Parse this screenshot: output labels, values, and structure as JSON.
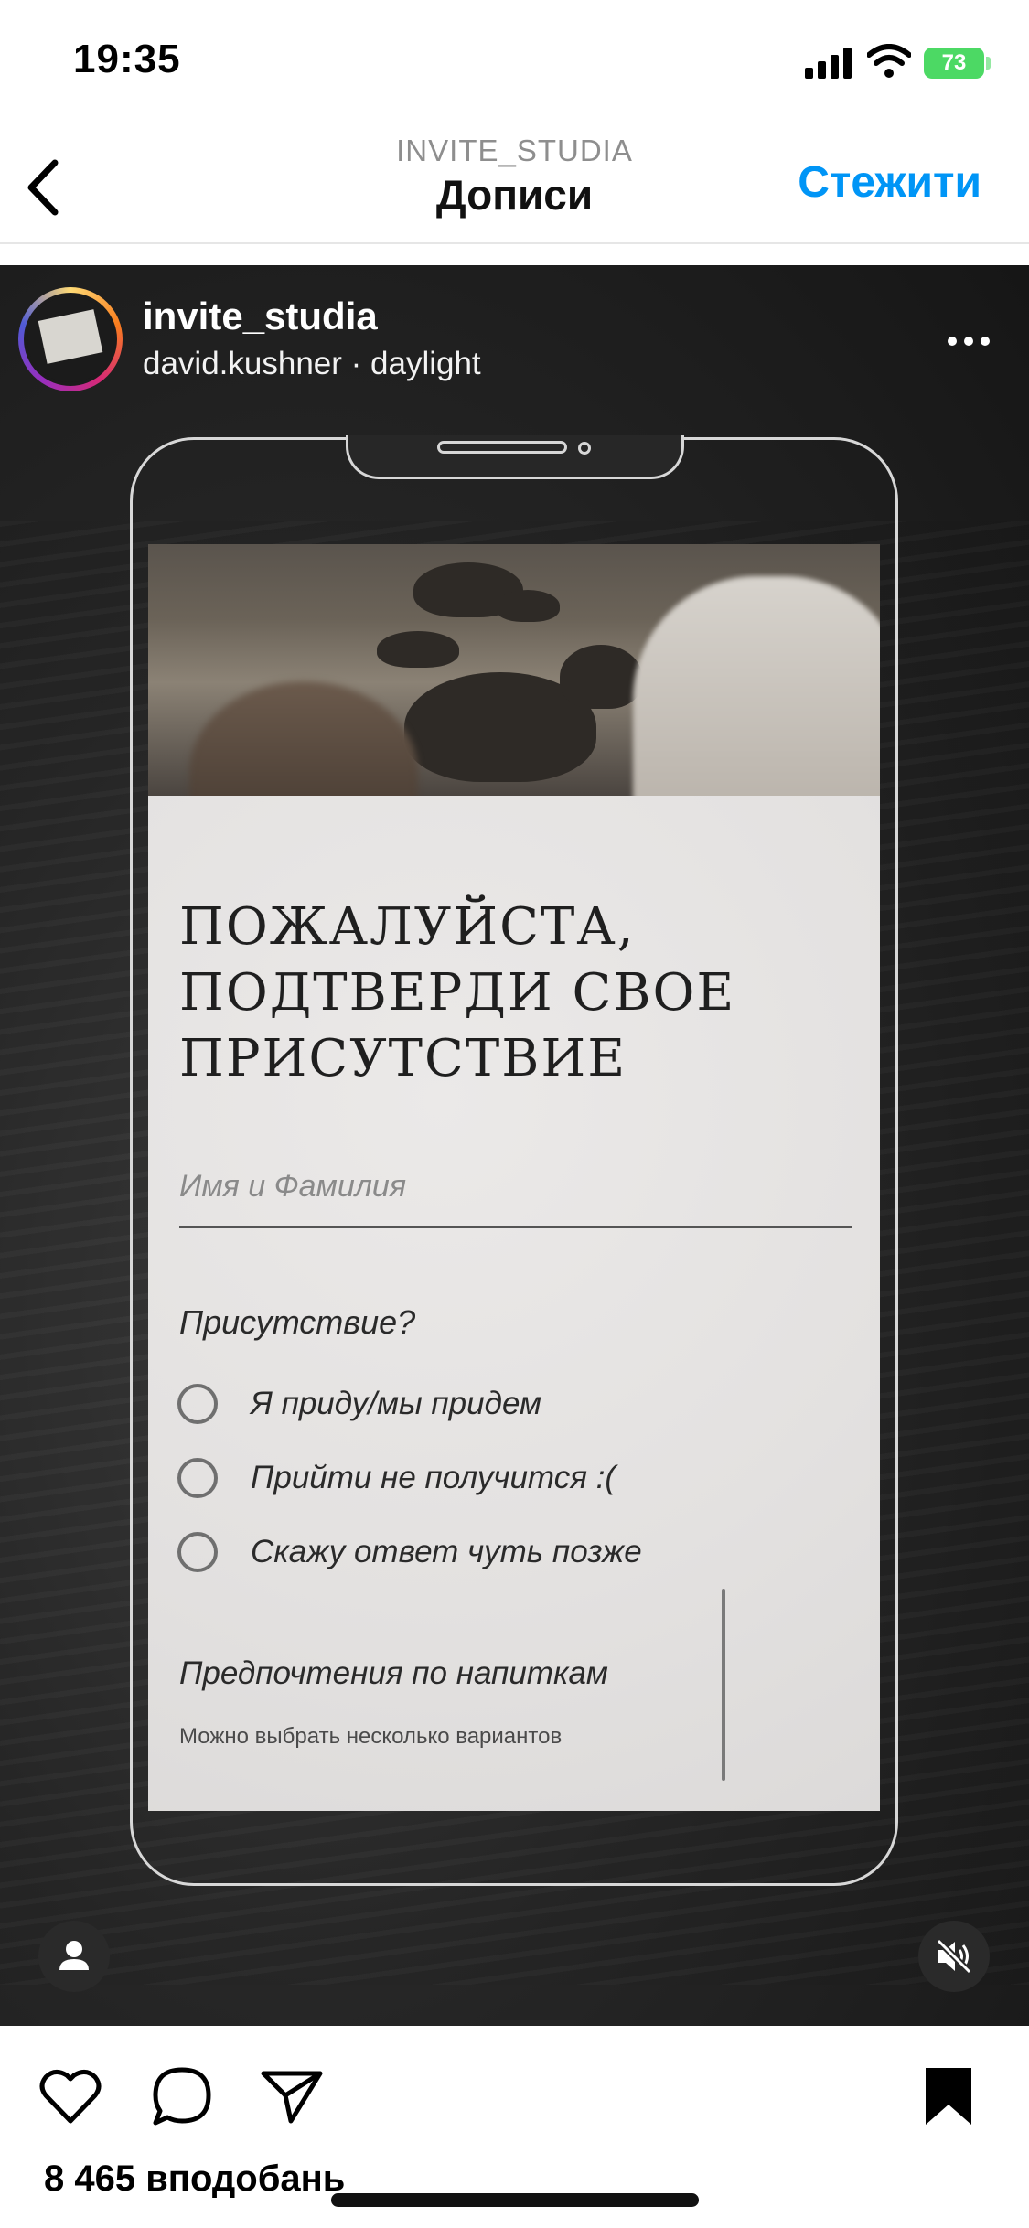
{
  "status_bar": {
    "time": "19:35",
    "battery": "73"
  },
  "header": {
    "subtitle": "INVITE_STUDIA",
    "title": "Дописи",
    "follow_label": "Стежити"
  },
  "post": {
    "username": "invite_studia",
    "audio": "david.kushner · daylight",
    "form": {
      "title": "Пожалуйста, подтверди свое присутствие",
      "name_placeholder": "Имя и Фамилия",
      "attendance_question": "Присутствие?",
      "options": [
        "Я приду/мы придем",
        "Прийти не получится :(",
        "Скажу ответ чуть позже"
      ],
      "drinks_label": "Предпочтения по напиткам",
      "drinks_hint": "Можно выбрать несколько вариантов"
    }
  },
  "footer": {
    "likes": "8 465 вподобань"
  },
  "icons": {
    "back": "chevron-left-icon",
    "more": "more-horizontal-icon",
    "tag": "person-icon",
    "mute": "speaker-muted-icon",
    "like": "heart-icon",
    "comment": "comment-icon",
    "share": "send-icon",
    "save": "bookmark-icon"
  },
  "colors": {
    "accent": "#0095f6",
    "battery": "#4cd964"
  }
}
